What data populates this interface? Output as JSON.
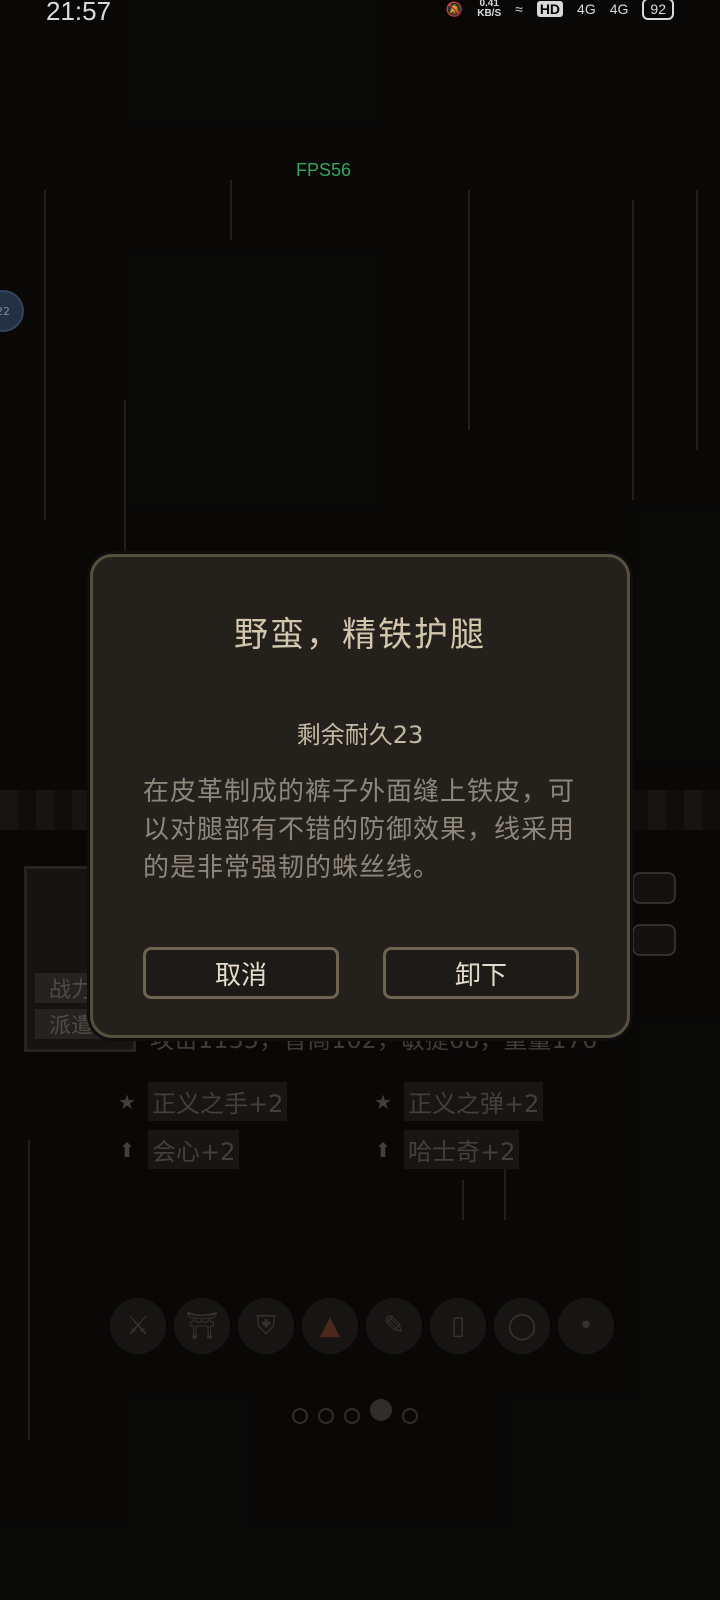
{
  "status_bar": {
    "time": "21:57",
    "net_rate_value": "0.41",
    "net_rate_unit": "KB/S",
    "hd_label": "HD",
    "signal1_label": "4G",
    "signal2_label": "4G",
    "battery": "92"
  },
  "fps": "FPS56",
  "side_badge": "22",
  "background": {
    "portrait_buttons": [
      "战力",
      "派遣"
    ],
    "stats_line": "攻击1135，智商102，敏捷68，重量176",
    "skills": [
      {
        "icon": "star-icon",
        "text": "正义之手+2"
      },
      {
        "icon": "star-icon",
        "text": "正义之弹+2"
      },
      {
        "icon": "arrow-up-icon",
        "text": "会心+2"
      },
      {
        "icon": "arrow-up-icon",
        "text": "哈士奇+2"
      }
    ],
    "equipment_slots": [
      "sword-icon",
      "helmet-icon",
      "armor-icon",
      "boots-icon",
      "scroll-icon",
      "leggings-icon",
      "ring-icon",
      "accessory-icon"
    ]
  },
  "dialog": {
    "title": "野蛮，精铁护腿",
    "durability": "剩余耐久23",
    "description": "在皮革制成的裤子外面缝上铁皮，可以对腿部有不错的防御效果，线采用的是非常强韧的蛛丝线。",
    "cancel_label": "取消",
    "unequip_label": "卸下"
  }
}
